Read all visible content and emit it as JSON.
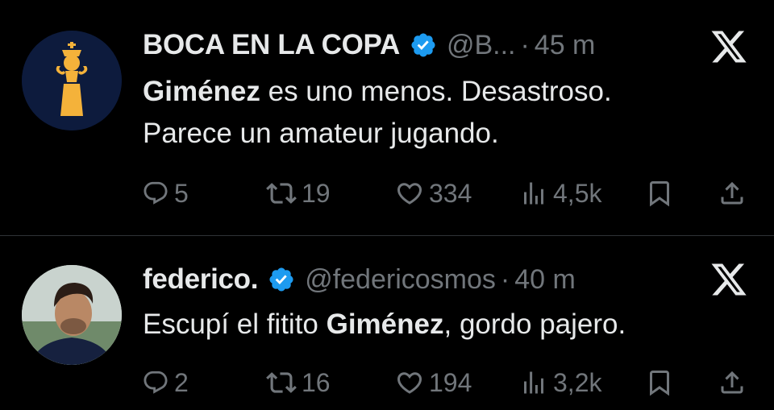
{
  "tweets": [
    {
      "name": "BOCA EN LA COPA",
      "handle": "@B...",
      "time": "45 m",
      "text_bold": "Giménez",
      "text_rest_line1": " es uno menos. Desastroso.",
      "text_line2": "Parece un amateur jugando.",
      "replies": "5",
      "retweets": "19",
      "likes": "334",
      "views": "4,5k",
      "avatar_icon": "trophy-icon"
    },
    {
      "name": "federico.",
      "handle": "@federicosmos",
      "time": "40 m",
      "text_pre": "Escupí el fitito ",
      "text_bold": "Giménez",
      "text_post": ", gordo pajero.",
      "replies": "2",
      "retweets": "16",
      "likes": "194",
      "views": "3,2k",
      "avatar_icon": "profile-photo"
    }
  ],
  "colors": {
    "background": "#000000",
    "text": "#e7e9ea",
    "muted": "#71767b",
    "verified": "#1d9bf0",
    "divider": "#2f3336"
  }
}
